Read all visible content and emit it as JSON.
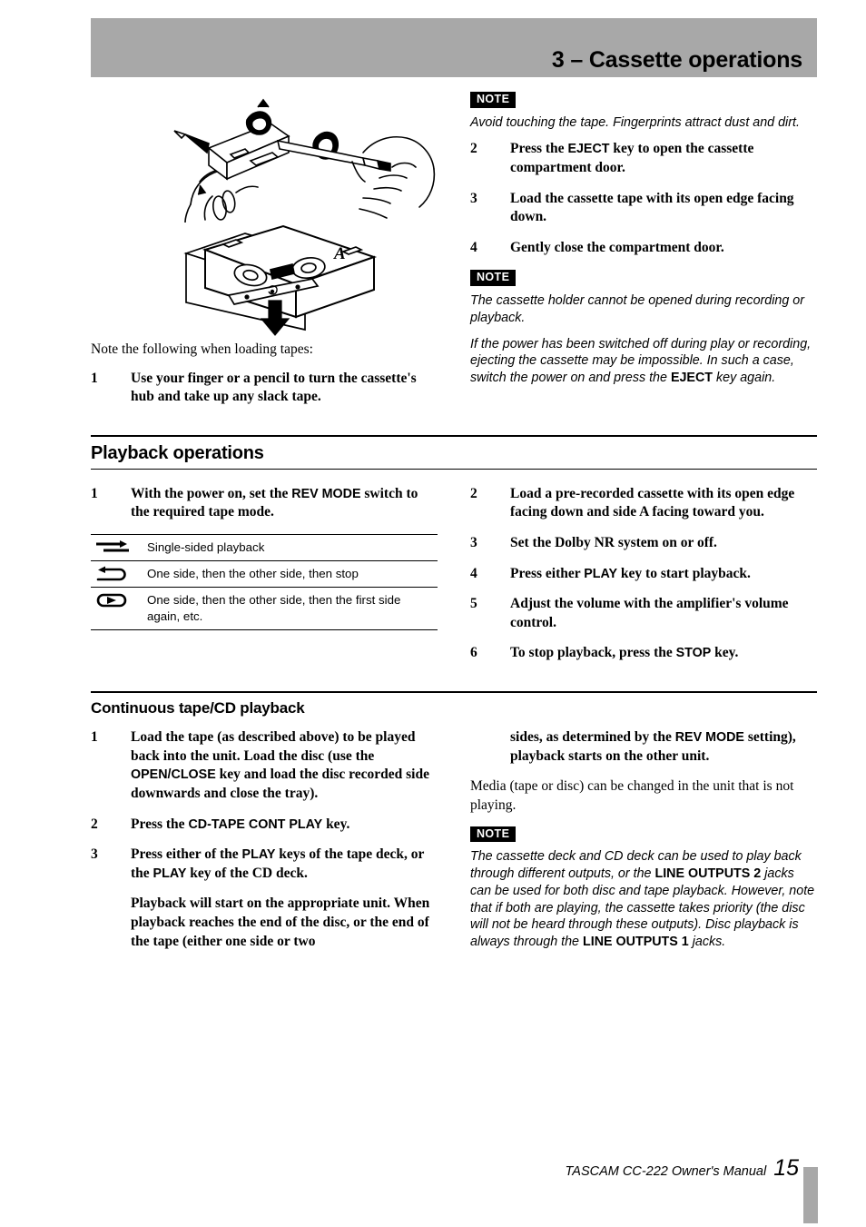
{
  "header": {
    "title": "3 – Cassette operations"
  },
  "illustrations": {
    "hands_pencil": "hands-turning-cassette-hub-with-pencil-illustration",
    "cassette_side_a": "cassette-loading-orientation-side-a-illustration",
    "cassette_label": "A"
  },
  "left_column": {
    "intro": "Note the following when loading tapes:",
    "step1": {
      "num": "1",
      "text": "Use your finger or a pencil to turn the cassette's hub and take up any slack tape."
    }
  },
  "right_column": {
    "note1": {
      "tag": "NOTE",
      "text": "Avoid touching the tape. Fingerprints attract dust and dirt."
    },
    "step2": {
      "num": "2",
      "pre": "Press the ",
      "key": "EJECT",
      "post": " key to open the cassette compartment door."
    },
    "step3": {
      "num": "3",
      "text": "Load the cassette tape with its open edge facing down."
    },
    "step4": {
      "num": "4",
      "text": "Gently close the compartment door."
    },
    "note2": {
      "tag": "NOTE",
      "para1": "The cassette holder cannot be opened during recording or playback.",
      "para2_pre": "If the power has been switched off during play or recording, ejecting the cassette may be impossible. In such a case, switch the power on and press the ",
      "para2_key": "EJECT",
      "para2_post": " key again."
    }
  },
  "playback_section": {
    "heading": "Playback operations",
    "left": {
      "step1": {
        "num": "1",
        "pre": "With the power on, set the ",
        "key": "REV MODE",
        "post": " switch to the required tape mode."
      },
      "rev_mode_table": {
        "rows": [
          {
            "icon": "single-sided-playback-icon",
            "desc": "Single-sided playback"
          },
          {
            "icon": "one-side-then-other-then-stop-icon",
            "desc": "One side, then the other side, then stop"
          },
          {
            "icon": "continuous-loop-playback-icon",
            "desc": "One side, then the other side, then the first side again, etc."
          }
        ]
      }
    },
    "right": {
      "step2": {
        "num": "2",
        "text": "Load a pre-recorded cassette with its open edge facing down and side A facing toward you."
      },
      "step3": {
        "num": "3",
        "text": "Set the Dolby NR system on or off."
      },
      "step4": {
        "num": "4",
        "pre": "Press either ",
        "key": "PLAY",
        "post": " key to start playback."
      },
      "step5": {
        "num": "5",
        "text": "Adjust the volume with the amplifier's volume control."
      },
      "step6": {
        "num": "6",
        "pre": "To stop playback, press the ",
        "key": "STOP",
        "post": " key."
      }
    }
  },
  "continuous_section": {
    "heading": "Continuous tape/CD playback",
    "left": {
      "step1": {
        "num": "1",
        "pre": "Load the tape (as described above) to be played back into the unit. Load the disc (use the ",
        "key": "OPEN/CLOSE",
        "post": " key and load the disc recorded side downwards and close the tray)."
      },
      "step2": {
        "num": "2",
        "pre": "Press the ",
        "key": "CD-TAPE CONT PLAY",
        "post": " key."
      },
      "step3": {
        "num": "3",
        "pre": "Press either of the ",
        "key": "PLAY",
        "mid": " keys of the tape deck, or the ",
        "key2": "PLAY",
        "post": " key of the CD deck."
      },
      "step3_cont": "Playback will start on the appropriate unit. When playback reaches the end of the disc, or the end of the tape (either one side or two"
    },
    "right": {
      "step_cont_pre": "sides, as determined by the ",
      "step_cont_key": "REV MODE",
      "step_cont_post": " setting), playback starts on the other unit.",
      "media_para": "Media (tape or disc) can be changed in the unit that is not playing.",
      "note": {
        "tag": "NOTE",
        "pre": "The cassette deck and CD deck can be used to play back through different outputs, or the ",
        "key1": "LINE OUTPUTS 2",
        "mid": " jacks can be used for both disc and tape playback. However, note that if both are playing, the cassette takes priority (the disc will not be heard through these outputs). Disc playback is always through the ",
        "key2": "LINE OUTPUTS 1",
        "post": " jacks."
      }
    }
  },
  "footer": {
    "text": "TASCAM CC-222 Owner's Manual",
    "page": "15"
  },
  "colors": {
    "header_band": "#a8a8a8",
    "footer_bar": "#a8a8a8",
    "text": "#000000"
  }
}
